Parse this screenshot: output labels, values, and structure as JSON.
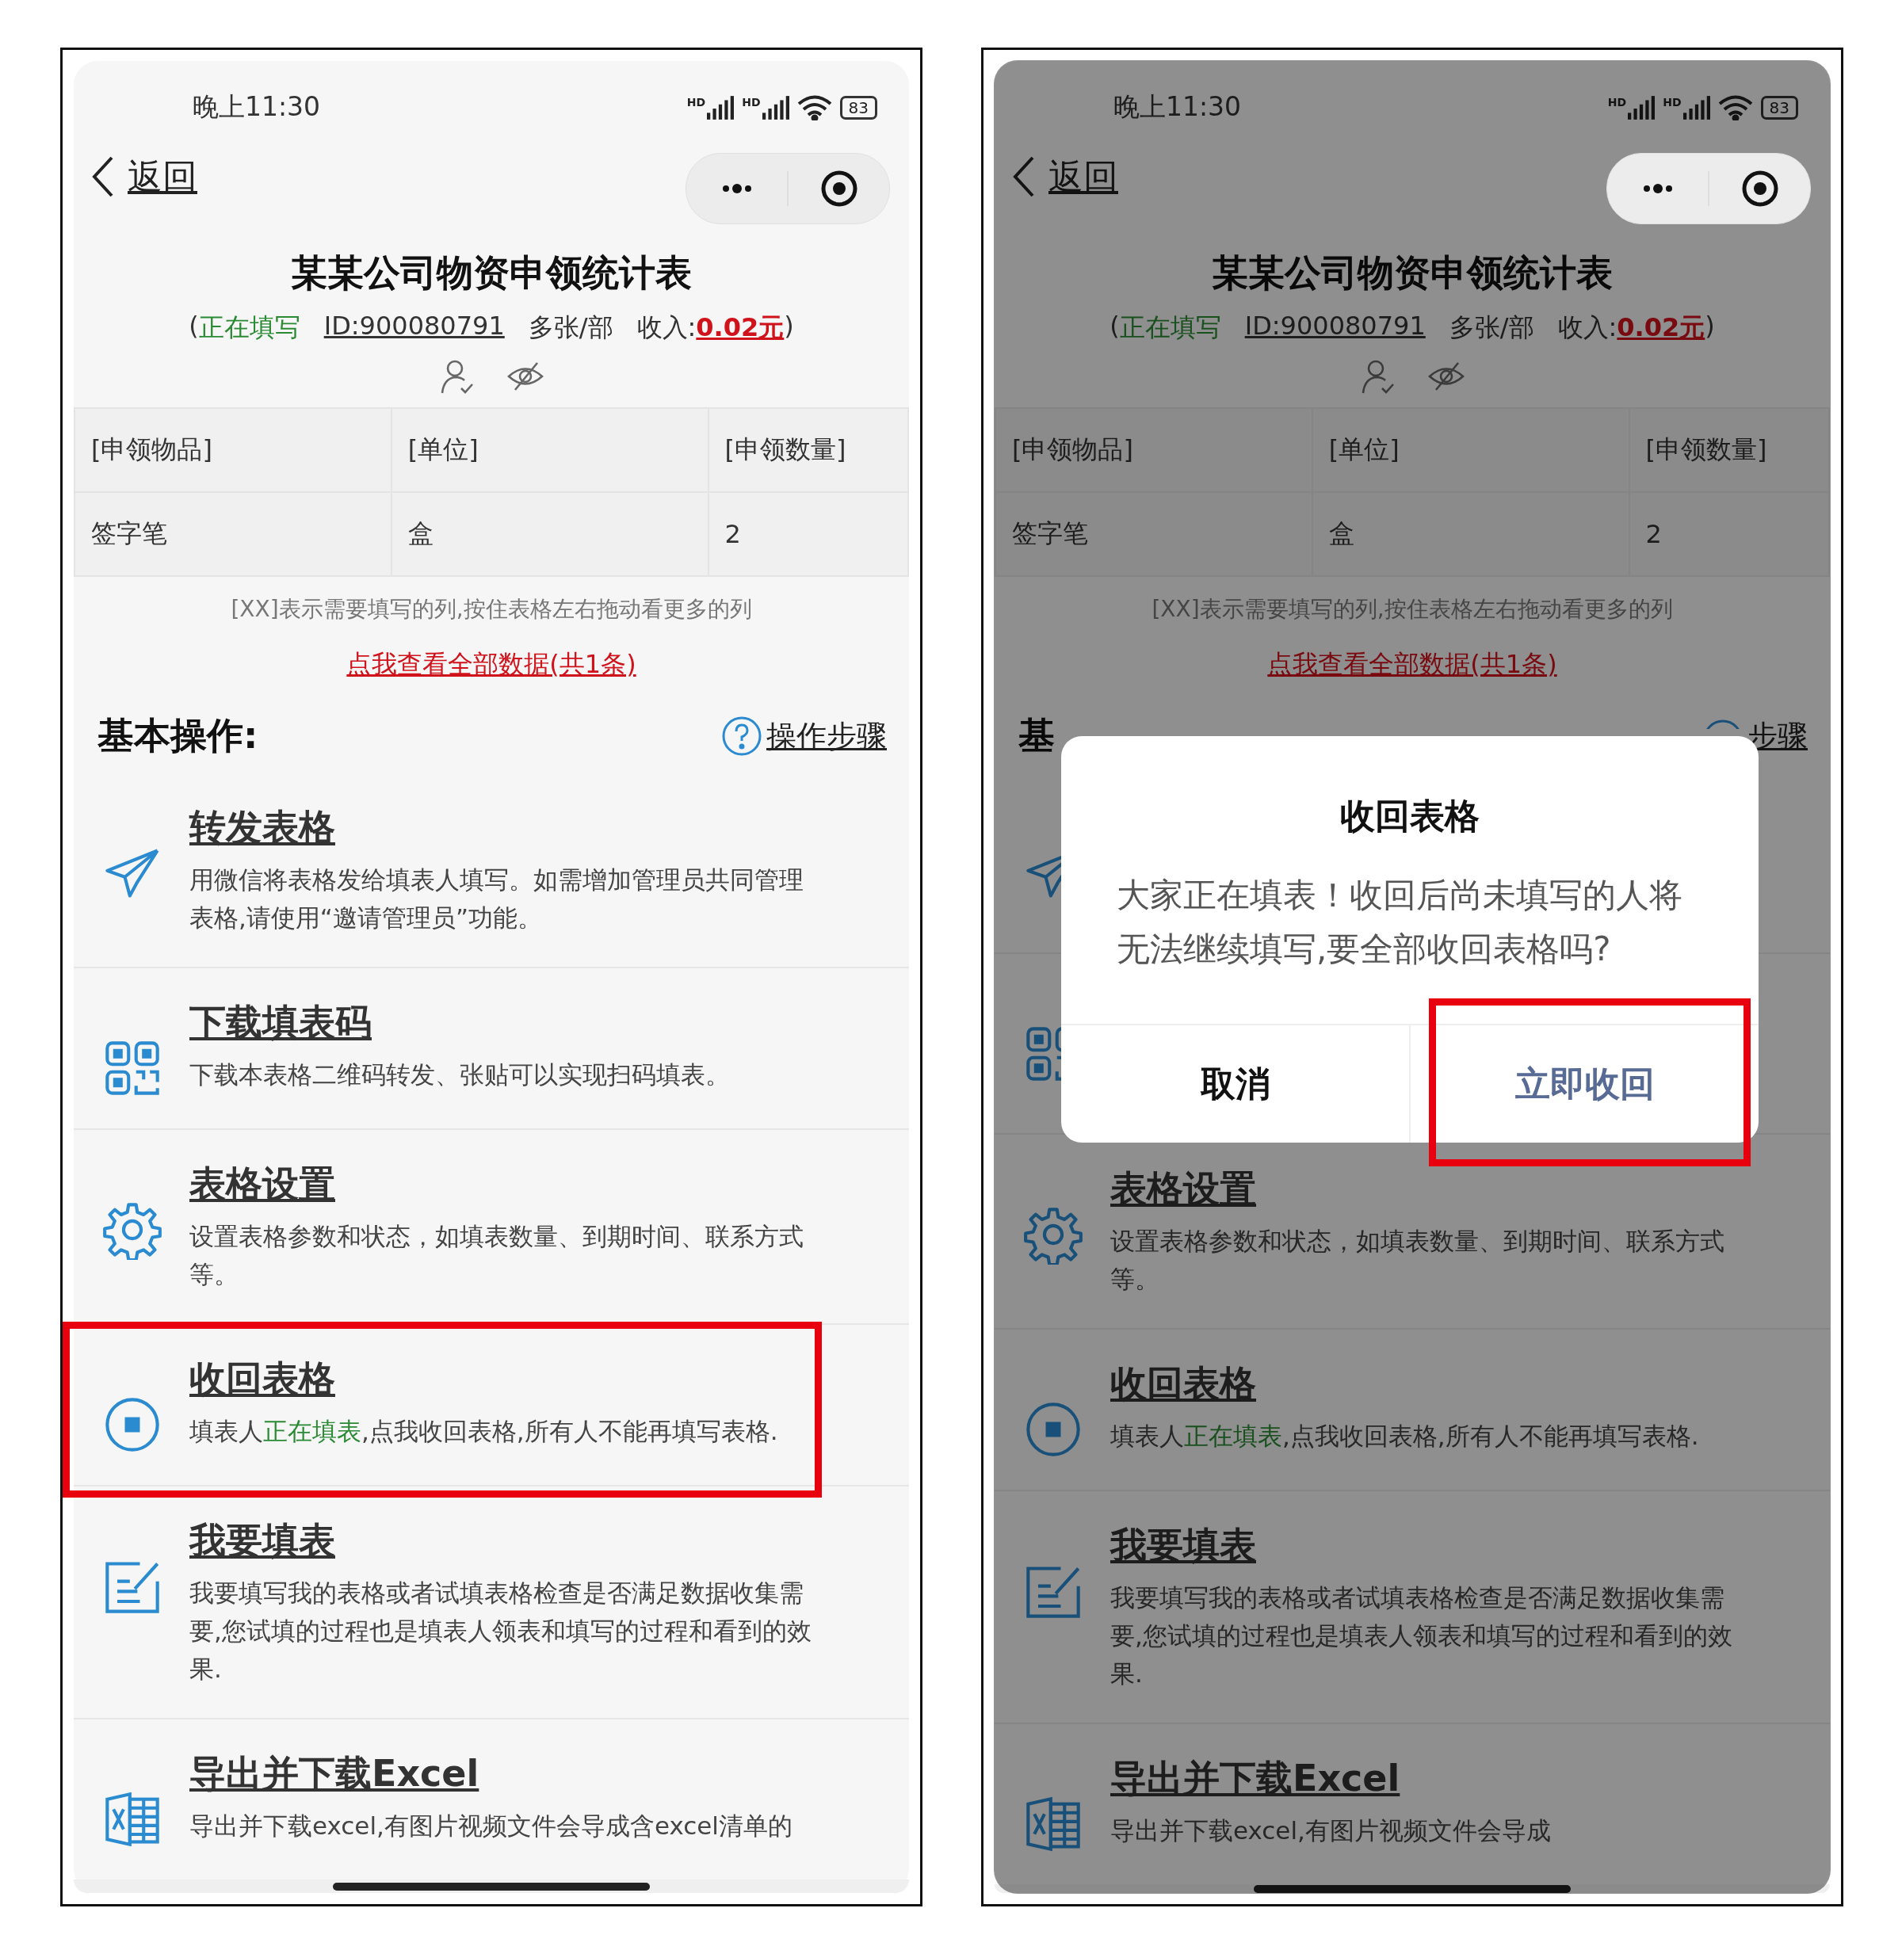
{
  "screens": [
    {
      "dimmed": false,
      "status_bar": {
        "time": "晚上11:30",
        "signal_labels": [
          "HD",
          "HD"
        ],
        "battery": "83"
      },
      "nav": {
        "back": "返回"
      },
      "title": "某某公司物资申领统计表",
      "meta": {
        "open": "(",
        "status": "正在填写",
        "id": "ID:900080791",
        "mode": "多张/部",
        "income_label": "收入:",
        "income": "0.02元",
        "close": ")"
      },
      "table": {
        "columns": [
          "[申领物品]",
          "[单位]",
          "[申领数量]"
        ],
        "rows": [
          [
            "签字笔",
            "盒",
            "2"
          ]
        ]
      },
      "hint": "[XX]表示需要填写的列,按住表格左右拖动看更多的列",
      "view_all_link": "点我查看全部数据(共1条)",
      "section": {
        "title": "基本操作:",
        "help_link": "操作步骤"
      },
      "items": [
        {
          "kind": "send",
          "title": "转发表格",
          "desc": [
            {
              "kind": "text",
              "text": "用微信将表格发给填表人填写。如需增加管理员共同管理表格,请使用“邀请管理员”功能。"
            }
          ],
          "highlight": false
        },
        {
          "kind": "qr",
          "title": "下载填表码",
          "desc": [
            {
              "kind": "text",
              "text": "下载本表格二维码转发、张贴可以实现扫码填表。"
            }
          ],
          "highlight": false
        },
        {
          "kind": "gear",
          "title": "表格设置",
          "desc": [
            {
              "kind": "text",
              "text": "设置表格参数和状态，如填表数量、到期时间、联系方式等。"
            }
          ],
          "highlight": false
        },
        {
          "kind": "stop",
          "title": "收回表格",
          "desc": [
            {
              "kind": "text",
              "text": "填表人"
            },
            {
              "kind": "status",
              "text": "正在填表"
            },
            {
              "kind": "text",
              "text": ",点我收回表格,所有人不能再填写表格."
            }
          ],
          "highlight": true
        },
        {
          "kind": "edit",
          "title": "我要填表",
          "desc": [
            {
              "kind": "text",
              "text": "我要填写我的表格或者试填表格检查是否满足数据收集需要,您试填的过程也是填表人领表和填写的过程和看到的效果."
            }
          ],
          "highlight": false
        },
        {
          "kind": "excel",
          "title": "导出并下载Excel",
          "desc": [
            {
              "kind": "text",
              "text": "导出并下载excel,有图片视频文件会导成含excel清单的"
            }
          ],
          "highlight": false
        }
      ]
    },
    {
      "dimmed": true,
      "status_bar": {
        "time": "晚上11:30",
        "signal_labels": [
          "HD",
          "HD"
        ],
        "battery": "83"
      },
      "nav": {
        "back": "返回"
      },
      "title": "某某公司物资申领统计表",
      "meta": {
        "open": "(",
        "status": "正在填写",
        "id": "ID:900080791",
        "mode": "多张/部",
        "income_label": "收入:",
        "income": "0.02元",
        "close": ")"
      },
      "table": {
        "columns": [
          "[申领物品]",
          "[单位]",
          "[申领数量]"
        ],
        "rows": [
          [
            "签字笔",
            "盒",
            "2"
          ]
        ]
      },
      "hint": "[XX]表示需要填写的列,按住表格左右拖动看更多的列",
      "view_all_link": "点我查看全部数据(共1条)",
      "section": {
        "title": "基",
        "help_link": "步骤"
      },
      "items": [
        {
          "kind": "send",
          "highlight": false
        },
        {
          "kind": "qr",
          "highlight": false
        },
        {
          "kind": "gear",
          "title": "表格设置",
          "desc": [
            {
              "kind": "text",
              "text": "设置表格参数和状态，如填表数量、到期时间、联系方式等。"
            }
          ],
          "highlight": false
        },
        {
          "kind": "stop",
          "title": "收回表格",
          "desc": [
            {
              "kind": "text",
              "text": "填表人"
            },
            {
              "kind": "status",
              "text": "正在填表"
            },
            {
              "kind": "text",
              "text": ",点我收回表格,所有人不能再填写表格."
            }
          ],
          "highlight": false
        },
        {
          "kind": "edit",
          "title": "我要填表",
          "desc": [
            {
              "kind": "text",
              "text": "我要填写我的表格或者试填表格检查是否满足数据收集需要,您试填的过程也是填表人领表和填写的过程和看到的效果."
            }
          ],
          "highlight": false
        },
        {
          "kind": "excel",
          "title": "导出并下载Excel",
          "desc": [
            {
              "kind": "text",
              "text": "导出并下载excel,有图片视频文件会导成"
            }
          ],
          "highlight": false
        }
      ],
      "dialog": {
        "title": "收回表格",
        "message": "大家正在填表！收回后尚未填写的人将无法继续填写,要全部收回表格吗?",
        "buttons": [
          {
            "kind": "cancel",
            "label": "取消",
            "highlight": false
          },
          {
            "kind": "confirm",
            "label": "立即收回",
            "highlight": true
          }
        ]
      }
    }
  ]
}
